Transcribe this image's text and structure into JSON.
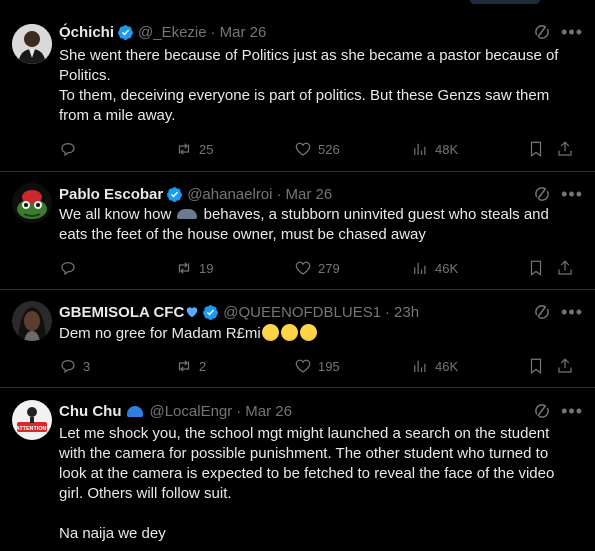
{
  "tweets": [
    {
      "name": "Ọ́chichi",
      "handle": "@_Ekezie",
      "time": "Mar 26",
      "text": [
        "She went there because of Politics just as she became a pastor because of Politics.",
        "To them, deceiving everyone is part of politics. But these Genzs saw them from a mile away."
      ],
      "replies": "",
      "reposts": "25",
      "likes": "526",
      "views": "48K"
    },
    {
      "name": "Pablo Escobar",
      "handle": "@ahanaelroi",
      "time": "Mar 26",
      "text_a": "We all know how",
      "text_b": "behaves, a stubborn uninvited guest who steals and eats the feet of the house owner, must be chased away",
      "replies": "",
      "reposts": "19",
      "likes": "279",
      "views": "46K"
    },
    {
      "name": "GBEMISOLA CFC",
      "handle": "@QUEENOFDBLUES1",
      "time": "23h",
      "text": "Dem no gree for Madam R£mi",
      "replies": "3",
      "reposts": "2",
      "likes": "195",
      "views": "46K"
    },
    {
      "name": "Chu Chu",
      "handle": "@LocalEngr",
      "time": "Mar 26",
      "avatar_text": "ATTENTION!",
      "text": [
        "Let me shock you, the school mgt might launched a search on the student with the camera for possible punishment. The other student who turned to look at the camera is expected to be fetched to reveal the face of the video girl. Others will follow suit.",
        "Na naija we dey"
      ]
    }
  ],
  "colors": {
    "accent": "#1d9bf0",
    "muted": "#71767b",
    "text": "#e7e9ea",
    "border": "#2f3336"
  },
  "icons": [
    "verified-badge-icon",
    "grok-icon",
    "more-icon",
    "reply-icon",
    "repost-icon",
    "like-icon",
    "views-icon",
    "bookmark-icon",
    "share-icon"
  ]
}
